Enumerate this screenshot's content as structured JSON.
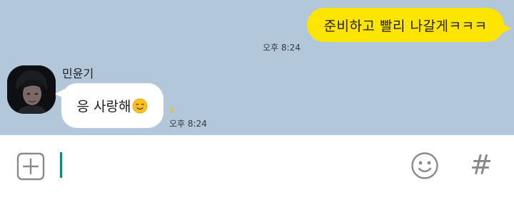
{
  "messages": [
    {
      "direction": "outgoing",
      "text": "준비하고 빨리 나갈게ㅋㅋㅋ",
      "time": "오후 8:24"
    },
    {
      "direction": "incoming",
      "sender": "민윤기",
      "text": "응 사랑해",
      "emoji": "smiling-face-with-smiling-eyes-emoji",
      "unread_count": "1",
      "time": "오후 8:24"
    }
  ],
  "input": {
    "value": "",
    "placeholder": ""
  },
  "icons": {
    "attach": "plus-square-icon",
    "emoticon": "smiley-icon",
    "hashtag": "#"
  },
  "colors": {
    "chat_background": "#b2c7da",
    "outgoing_bubble": "#fee500",
    "incoming_bubble": "#ffffff",
    "cursor": "#11877c",
    "unread_count": "#e6c12a"
  }
}
